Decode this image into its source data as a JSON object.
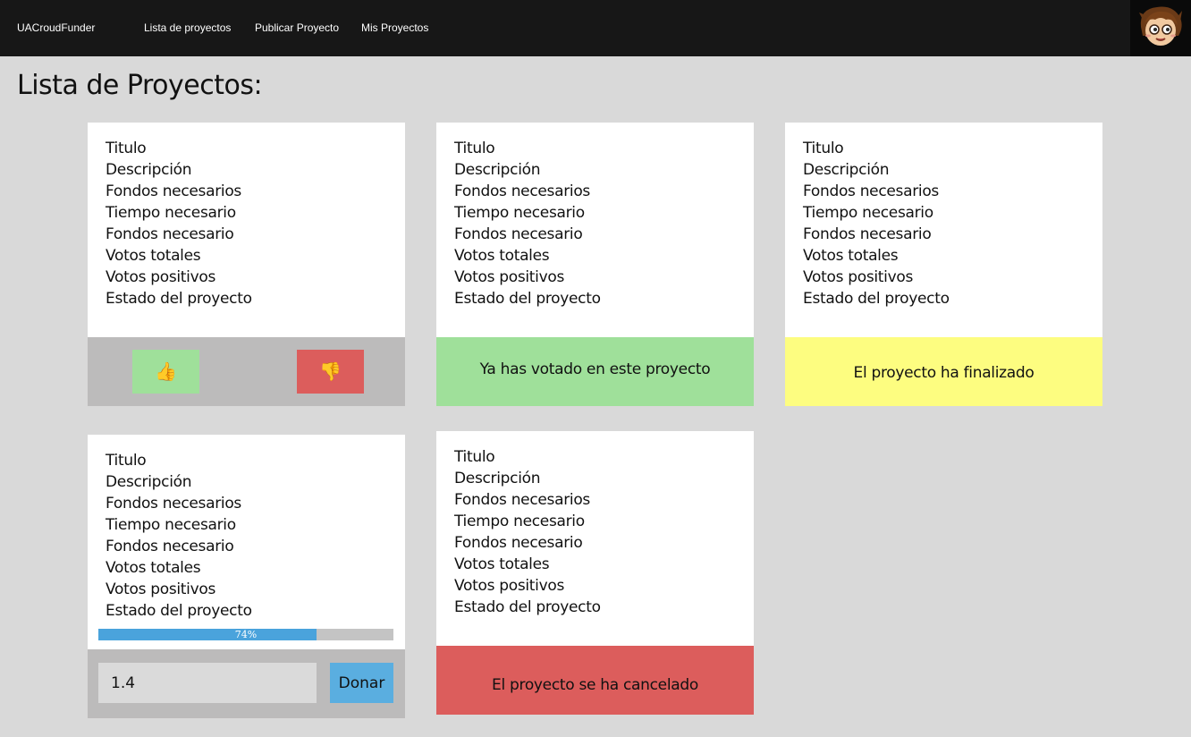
{
  "navbar": {
    "brand": "UACroudFunder",
    "links": [
      "Lista de proyectos",
      "Publicar Proyecto",
      "Mis Proyectos"
    ]
  },
  "page": {
    "title": "Lista de Proyectos:"
  },
  "fields": [
    "Titulo",
    "Descripción",
    "Fondos necesarios",
    "Tiempo necesario",
    "Fondos necesario",
    "Votos totales",
    "Votos positivos",
    "Estado del proyecto"
  ],
  "cards": [
    {
      "status": "voting",
      "upvote_icon": "thumbs-up-icon",
      "downvote_icon": "thumbs-down-icon",
      "upvote_glyph": "👍",
      "downvote_glyph": "👎"
    },
    {
      "status": "voted",
      "message": "Ya has votado en este proyecto"
    },
    {
      "status": "finished",
      "message": "El proyecto ha finalizado"
    },
    {
      "status": "funding",
      "progress": 0.74,
      "progress_label": "74%",
      "donation_value": "1.4",
      "donate_label": "Donar"
    },
    {
      "status": "cancelled",
      "message": "El proyecto se ha cancelado"
    }
  ],
  "colors": {
    "navbar": "#171717",
    "background": "#d9d9d9",
    "vote_footer": "#bcbbbb",
    "upvote": "#9fe09a",
    "downvote": "#dc5d5c",
    "voted": "#9fe09a",
    "finished": "#fdfd80",
    "cancelled": "#dc5d5c",
    "progress": "#4aa3dc",
    "donate": "#5aaee0"
  }
}
